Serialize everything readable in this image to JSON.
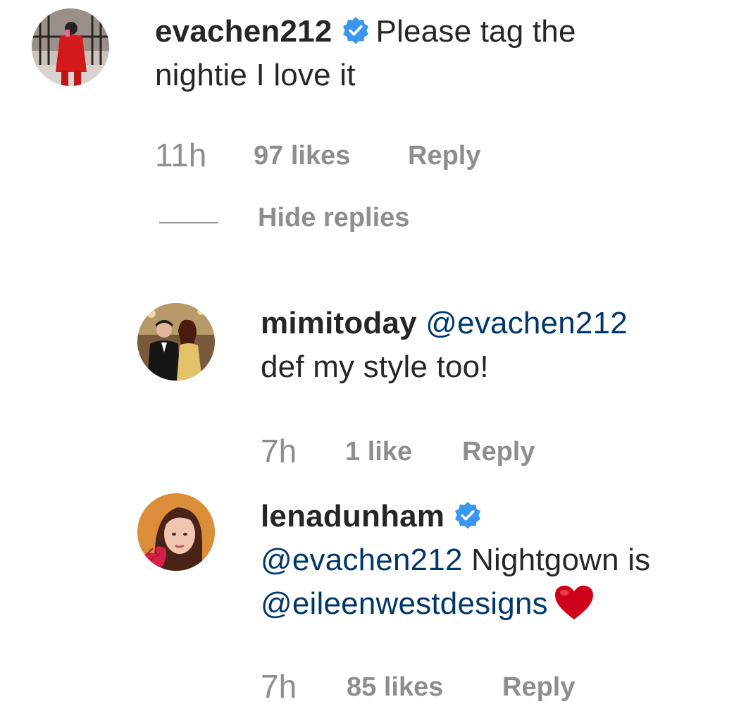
{
  "comments": [
    {
      "username": "evachen212",
      "verified": true,
      "body_text": "Please tag the",
      "body_text_2": "nightie I love it",
      "time": "11h",
      "likes": "97 likes",
      "reply": "Reply"
    }
  ],
  "hide_replies_label": "Hide replies",
  "replies": [
    {
      "username": "mimitoday",
      "verified": false,
      "mention": "@evachen212",
      "body_text": "def my style too!",
      "time": "7h",
      "likes": "1 like",
      "reply": "Reply"
    },
    {
      "username": "lenadunham",
      "verified": true,
      "mention": "@evachen212",
      "body_text": "Nightgown is",
      "mention_2": "@eileenwestdesigns",
      "emoji": "heart-emoji",
      "time": "7h",
      "likes": "85 likes",
      "reply": "Reply"
    }
  ],
  "colors": {
    "text": "#262626",
    "meta": "#8e8e8e",
    "mention": "#00376b",
    "verified": "#3897f0",
    "heart": "#d0021b"
  }
}
